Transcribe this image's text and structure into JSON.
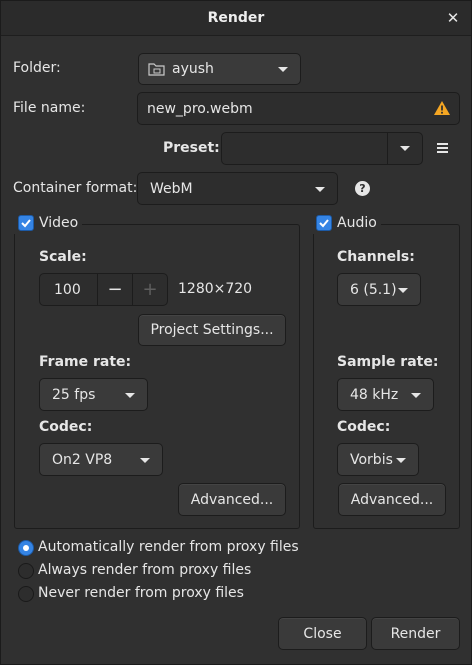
{
  "window": {
    "title": "Render"
  },
  "folder": {
    "label": "Folder:",
    "value": "ayush"
  },
  "file": {
    "label": "File name:",
    "value": "new_pro.webm"
  },
  "preset": {
    "label": "Preset:",
    "value": ""
  },
  "container": {
    "label": "Container format:",
    "value": "WebM"
  },
  "video": {
    "label": "Video",
    "enabled": true,
    "scale_label": "Scale:",
    "scale_value": "100",
    "minus": "−",
    "plus": "+",
    "resolution": "1280×720",
    "project_settings_label": "Project Settings...",
    "frame_rate_label": "Frame rate:",
    "frame_rate_value": "25 fps",
    "codec_label": "Codec:",
    "codec_value": "On2 VP8",
    "advanced_label": "Advanced..."
  },
  "audio": {
    "label": "Audio",
    "enabled": true,
    "channels_label": "Channels:",
    "channels_value": "6 (5.1)",
    "sample_rate_label": "Sample rate:",
    "sample_rate_value": "48 kHz",
    "codec_label": "Codec:",
    "codec_value": "Vorbis",
    "advanced_label": "Advanced..."
  },
  "proxy": {
    "selected_index": 0,
    "options": [
      "Automatically render from proxy files",
      "Always render from proxy files",
      "Never render from proxy files"
    ]
  },
  "footer": {
    "close_label": "Close",
    "render_label": "Render"
  },
  "colors": {
    "accent": "#3584e4",
    "warning": "#f5a623",
    "background": "#303030"
  },
  "icons": [
    "close-icon",
    "folder-icon",
    "warning-icon",
    "menu-icon",
    "help-icon",
    "checkmark-icon"
  ]
}
